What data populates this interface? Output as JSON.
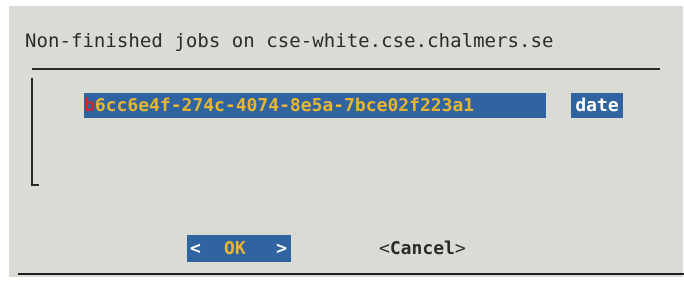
{
  "dialog": {
    "title": "Non-finished jobs on cse-white.cse.chalmers.se"
  },
  "job_list": {
    "items": [
      {
        "tag_hotkey": "b",
        "tag_rest": "6cc6e4f-274c-4074-8e5a-7bce02f223a1",
        "item": "date"
      }
    ]
  },
  "buttons": {
    "ok": {
      "left_bracket": "<",
      "label": "OK",
      "right_bracket": ">"
    },
    "cancel": {
      "left_bracket": "<",
      "label": "Cancel",
      "right_bracket": ">"
    }
  },
  "colors": {
    "dialog_background": "#d9dcd5",
    "selection_background": "#3064a1",
    "hotkey": "#cb2727",
    "highlight_text": "#e8b531",
    "text": "#2a2a2a"
  }
}
